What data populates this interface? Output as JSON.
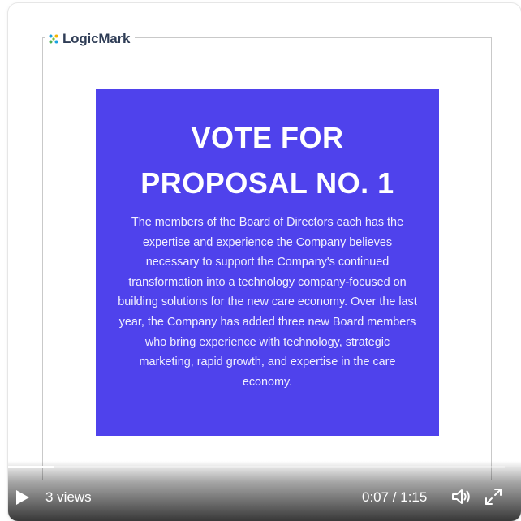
{
  "video": {
    "logo_text": "LogicMark",
    "logo_icon": "logicmark-dots-icon",
    "headline_line1": "VOTE FOR",
    "headline_line2": "PROPOSAL NO. 1",
    "body": "The members of the Board of Directors each has the expertise and experience the Company believes necessary to support the Company's continued transformation into a technology company-focused on building solutions for the new care economy. Over the last year, the Company has added three new Board members who bring experience with technology, strategic marketing, rapid growth, and expertise in the care economy.",
    "panel_color": "#4f42ec"
  },
  "controls": {
    "views": "3 views",
    "time": "0:07 / 1:15",
    "progress_fraction": 0.093,
    "play_icon": "play-icon",
    "volume_icon": "volume-icon",
    "fullscreen_icon": "expand-icon"
  }
}
